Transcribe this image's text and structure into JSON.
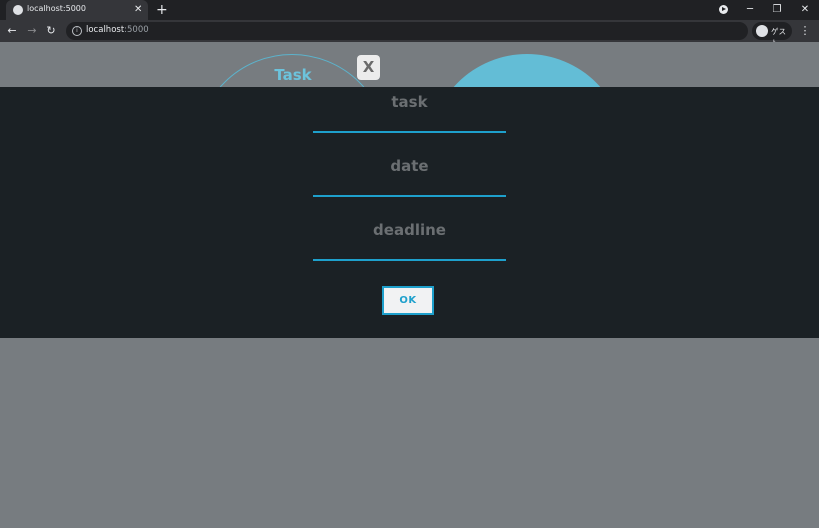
{
  "browser": {
    "tab": {
      "title": "localhost:5000",
      "close": "✕"
    },
    "new_tab": "+",
    "window_controls": {
      "minimize": "─",
      "restore": "❐",
      "close": "✕"
    },
    "nav": {
      "back": "←",
      "forward": "→",
      "reload": "↻"
    },
    "omnibox": {
      "info": "i",
      "host": "localhost",
      "port": ":5000"
    },
    "profile": {
      "label": "ゲスト"
    },
    "menu": "⋮"
  },
  "page": {
    "background_task_label": "Task",
    "close_button": "X",
    "form": {
      "fields": [
        {
          "label": "task"
        },
        {
          "label": "date"
        },
        {
          "label": "deadline"
        }
      ],
      "ok_label": "OK"
    }
  },
  "colors": {
    "accent": "#1ea0cc",
    "modal_bg": "#1b2125",
    "page_bg": "#777c80",
    "circle": "#63bdd6"
  }
}
